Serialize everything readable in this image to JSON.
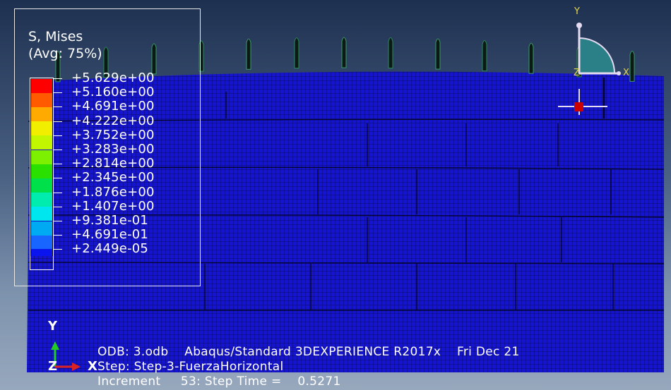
{
  "legend": {
    "title_line1": "S, Mises",
    "title_line2": "(Avg: 75%)",
    "entries": [
      {
        "value": "+5.629e+00",
        "color": "#ff0000"
      },
      {
        "value": "+5.160e+00",
        "color": "#ff5a00"
      },
      {
        "value": "+4.691e+00",
        "color": "#ffaa00"
      },
      {
        "value": "+4.222e+00",
        "color": "#f2ee00"
      },
      {
        "value": "+3.752e+00",
        "color": "#c2f500"
      },
      {
        "value": "+3.283e+00",
        "color": "#7cf000"
      },
      {
        "value": "+2.814e+00",
        "color": "#2ae000"
      },
      {
        "value": "+2.345e+00",
        "color": "#00e04a"
      },
      {
        "value": "+1.876e+00",
        "color": "#00ecae"
      },
      {
        "value": "+1.407e+00",
        "color": "#00e6ee"
      },
      {
        "value": "+9.381e-01",
        "color": "#00aaf2"
      },
      {
        "value": "+4.691e-01",
        "color": "#1865ff"
      },
      {
        "value": "+2.449e-05",
        "color": "#0a14ee"
      }
    ]
  },
  "info": {
    "odb_line": "ODB: 3.odb    Abaqus/Standard 3DEXPERIENCE R2017x    Fri Dec 21",
    "step_line": "Step: Step-3-FuerzaHorizontal",
    "increment_line": "Increment     53: Step Time =    0.5271"
  },
  "view_triad": {
    "y_label": "Y",
    "z_label": "Z",
    "x_label": "X"
  },
  "corner_triad": {
    "y_label": "Y",
    "z_label": "Z",
    "x_label": "X"
  },
  "colors": {
    "mesh_fill": "#1414d2",
    "mesh_line": "#0a0a4a",
    "quad_fill": "#2b7f86",
    "point_marker": "#cc0000"
  }
}
